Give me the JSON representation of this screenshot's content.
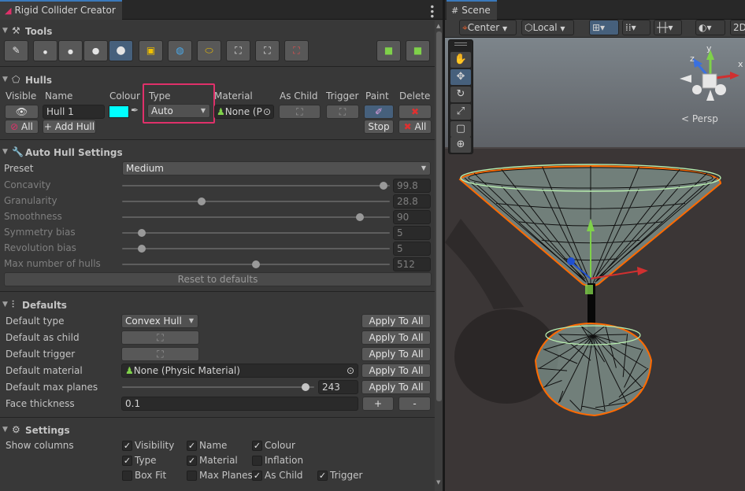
{
  "left_window": {
    "tab_title": "Rigid Collider Creator",
    "tools": {
      "header": "Tools",
      "buttons": [
        "pencil-tool",
        "dot-xs",
        "dot-s",
        "dot-m",
        "dot-l",
        "box-hull",
        "sphere-hull",
        "capsule-hull",
        "select-box",
        "select-crop",
        "bounding-box",
        "add-collider",
        "delete-collider"
      ]
    },
    "hulls": {
      "header": "Hulls",
      "columns": {
        "visible": "Visible",
        "name": "Name",
        "colour": "Colour",
        "type": "Type",
        "material": "Material",
        "as_child": "As Child",
        "trigger": "Trigger",
        "paint": "Paint",
        "delete": "Delete"
      },
      "row": {
        "name": "Hull 1",
        "colour": "#00ffff",
        "type": "Auto",
        "material": "None (P"
      },
      "all_visible_label": "All",
      "add_hull_label": "+ Add Hull",
      "stop_label": "Stop",
      "delete_all_label": "All",
      "highlight_color": "#e0306a"
    },
    "auto_hull": {
      "header": "Auto Hull Settings",
      "preset_label": "Preset",
      "preset_value": "Medium",
      "sliders": [
        {
          "label": "Concavity",
          "value": "99.8",
          "fraction": 0.99
        },
        {
          "label": "Granularity",
          "value": "28.8",
          "fraction": 0.29
        },
        {
          "label": "Smoothness",
          "value": "90",
          "fraction": 0.9
        },
        {
          "label": "Symmetry bias",
          "value": "5",
          "fraction": 0.06
        },
        {
          "label": "Revolution bias",
          "value": "5",
          "fraction": 0.06
        },
        {
          "label": "Max number of hulls",
          "value": "512",
          "fraction": 0.5
        }
      ],
      "reset_label": "Reset to defaults"
    },
    "defaults": {
      "header": "Defaults",
      "default_type_label": "Default type",
      "default_type_value": "Convex Hull",
      "as_child_label": "Default as child",
      "trigger_label": "Default trigger",
      "material_label": "Default material",
      "material_value": "None (Physic Material)",
      "max_planes_label": "Default max planes",
      "max_planes_value": "243",
      "max_planes_fraction": 0.99,
      "face_thickness_label": "Face thickness",
      "face_thickness_value": "0.1",
      "apply_label": "Apply To All",
      "plus_label": "+",
      "minus_label": "-"
    },
    "settings": {
      "header": "Settings",
      "show_columns_label": "Show columns",
      "checkboxes": [
        {
          "label": "Visibility",
          "checked": true
        },
        {
          "label": "Name",
          "checked": true
        },
        {
          "label": "Colour",
          "checked": true
        },
        {
          "label": "Type",
          "checked": true
        },
        {
          "label": "Material",
          "checked": true
        },
        {
          "label": "Inflation",
          "checked": false
        },
        {
          "label": "Box Fit",
          "checked": false
        },
        {
          "label": "Max Planes",
          "checked": false
        },
        {
          "label": "As Child",
          "checked": true
        },
        {
          "label": "Trigger",
          "checked": true
        }
      ]
    }
  },
  "scene_window": {
    "tab_title": "Scene",
    "toolbar": {
      "pivot": "Center",
      "space": "Local",
      "mode_2d": "2D"
    },
    "gizmo_label": "Persp",
    "gizmo_axes": {
      "y": "y",
      "x": "x",
      "z": "z"
    },
    "colors": {
      "ground": "#3b3636",
      "sky": "#6a7178",
      "outline": "#ff6a00",
      "wire": "#101010",
      "mesh": "#8fa8a0"
    }
  }
}
